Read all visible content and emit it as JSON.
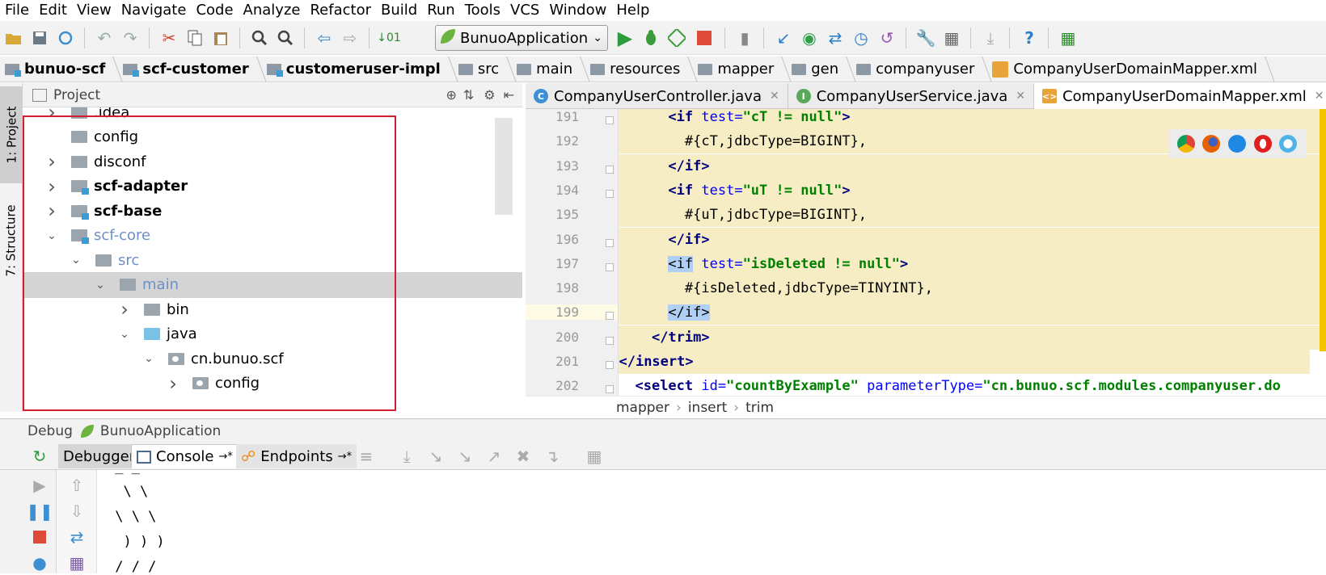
{
  "menubar": [
    "File",
    "Edit",
    "View",
    "Navigate",
    "Code",
    "Analyze",
    "Refactor",
    "Build",
    "Run",
    "Tools",
    "VCS",
    "Window",
    "Help"
  ],
  "toolbar": {
    "run_config": "BunuoApplication",
    "icons": [
      "open-folder-icon",
      "save-icon",
      "sync-icon",
      "undo-icon",
      "redo-icon",
      "cut-icon",
      "copy-icon",
      "paste-icon",
      "find-icon",
      "find-usages-icon",
      "back-icon",
      "forward-icon",
      "build-icon",
      "run-icon",
      "debug-icon",
      "coverage-icon",
      "stop-icon",
      "attach-icon",
      "vcs-update-icon",
      "vcs-commit-icon",
      "vcs-compare-icon",
      "vcs-history-icon",
      "vcs-revert-icon",
      "settings-icon",
      "project-structure-icon",
      "download-icon",
      "help-icon",
      "plugin-icon"
    ]
  },
  "breadcrumbs": [
    {
      "label": "bunuo-scf",
      "bold": true
    },
    {
      "label": "scf-customer",
      "bold": true
    },
    {
      "label": "customeruser-impl",
      "bold": true
    },
    {
      "label": "src",
      "bold": false
    },
    {
      "label": "main",
      "bold": false
    },
    {
      "label": "resources",
      "bold": false
    },
    {
      "label": "mapper",
      "bold": false
    },
    {
      "label": "gen",
      "bold": false
    },
    {
      "label": "companyuser",
      "bold": false
    },
    {
      "label": "CompanyUserDomainMapper.xml",
      "bold": false
    }
  ],
  "side_tabs": {
    "project": "1: Project",
    "structure": "7: Structure"
  },
  "project_panel": {
    "title": "Project",
    "tree": [
      {
        "label": ".idea",
        "depth": 0,
        "expand": "collapsed",
        "type": "folder",
        "style": "normal"
      },
      {
        "label": "config",
        "depth": 0,
        "expand": "none",
        "type": "folder",
        "style": "normal"
      },
      {
        "label": "disconf",
        "depth": 0,
        "expand": "collapsed",
        "type": "folder",
        "style": "normal"
      },
      {
        "label": "scf-adapter",
        "depth": 0,
        "expand": "collapsed",
        "type": "module",
        "style": "bold"
      },
      {
        "label": "scf-base",
        "depth": 0,
        "expand": "collapsed",
        "type": "module",
        "style": "bold"
      },
      {
        "label": "scf-core",
        "depth": 0,
        "expand": "expanded",
        "type": "module",
        "style": "dim"
      },
      {
        "label": "src",
        "depth": 1,
        "expand": "expanded",
        "type": "folder",
        "style": "dim"
      },
      {
        "label": "main",
        "depth": 2,
        "expand": "expanded",
        "type": "folder",
        "style": "dim",
        "selected": true
      },
      {
        "label": "bin",
        "depth": 3,
        "expand": "collapsed",
        "type": "folder",
        "style": "normal"
      },
      {
        "label": "java",
        "depth": 3,
        "expand": "expanded",
        "type": "source",
        "style": "normal"
      },
      {
        "label": "cn.bunuo.scf",
        "depth": 4,
        "expand": "expanded",
        "type": "package",
        "style": "normal"
      },
      {
        "label": "config",
        "depth": 5,
        "expand": "collapsed",
        "type": "package",
        "style": "normal"
      }
    ]
  },
  "editor": {
    "tabs": [
      {
        "label": "CompanyUserController.java",
        "icon": "C",
        "color": "#3f8fd6",
        "active": false
      },
      {
        "label": "CompanyUserService.java",
        "icon": "I",
        "color": "#5aa85a",
        "active": false
      },
      {
        "label": "CompanyUserDomainMapper.xml",
        "icon": "<>",
        "color": "#e8a33a",
        "active": true
      }
    ],
    "lines": [
      {
        "n": "191",
        "segments": [
          [
            "plain",
            "      "
          ],
          [
            "tag",
            "<if "
          ],
          [
            "attr",
            "test="
          ],
          [
            "str",
            "\"cT != null\""
          ],
          [
            "tag",
            ">"
          ]
        ]
      },
      {
        "n": "192",
        "segments": [
          [
            "plain",
            "        #{cT,jdbcType=BIGINT},"
          ]
        ]
      },
      {
        "n": "193",
        "segments": [
          [
            "plain",
            "      "
          ],
          [
            "tag",
            "</if>"
          ]
        ]
      },
      {
        "n": "194",
        "segments": [
          [
            "plain",
            "      "
          ],
          [
            "tag",
            "<if "
          ],
          [
            "attr",
            "test="
          ],
          [
            "str",
            "\"uT != null\""
          ],
          [
            "tag",
            ">"
          ]
        ]
      },
      {
        "n": "195",
        "segments": [
          [
            "plain",
            "        #{uT,jdbcType=BIGINT},"
          ]
        ]
      },
      {
        "n": "196",
        "segments": [
          [
            "plain",
            "      "
          ],
          [
            "tag",
            "</if>"
          ]
        ]
      },
      {
        "n": "197",
        "segments": [
          [
            "plain",
            "      "
          ],
          [
            "hltag",
            "<if"
          ],
          [
            "tag",
            " "
          ],
          [
            "attr",
            "test="
          ],
          [
            "str",
            "\"isDeleted != null\""
          ],
          [
            "tag",
            ">"
          ]
        ]
      },
      {
        "n": "198",
        "segments": [
          [
            "plain",
            "        #{isDeleted,jdbcType=TINYINT},"
          ]
        ]
      },
      {
        "n": "199",
        "segments": [
          [
            "plain",
            "      "
          ],
          [
            "hltag",
            "</if>"
          ]
        ]
      },
      {
        "n": "200",
        "segments": [
          [
            "plain",
            "    "
          ],
          [
            "tag",
            "</trim>"
          ]
        ]
      },
      {
        "n": "201",
        "segments": [
          [
            "plain",
            "  "
          ],
          [
            "tag",
            "</insert>"
          ]
        ]
      },
      {
        "n": "202",
        "segments": [
          [
            "plain",
            "  "
          ],
          [
            "tag",
            "<select "
          ],
          [
            "attr",
            "id="
          ],
          [
            "str",
            "\"countByExample\""
          ],
          [
            "attr",
            " parameterType="
          ],
          [
            "str",
            "\"cn.bunuo.scf.modules.companyuser.do"
          ]
        ]
      }
    ],
    "breadcrumb": [
      "mapper",
      "insert",
      "trim"
    ],
    "browser_icons": [
      "chrome-icon",
      "firefox-icon",
      "safari-icon",
      "opera-icon",
      "ie-icon"
    ]
  },
  "debug": {
    "title": "Debug",
    "config": "BunuoApplication",
    "tabs": [
      "Debugger",
      "Console",
      "Endpoints"
    ],
    "console_lines": [
      " _ _",
      "  \\ \\",
      " \\ \\ \\",
      "  ) ) )",
      " / / /"
    ]
  }
}
